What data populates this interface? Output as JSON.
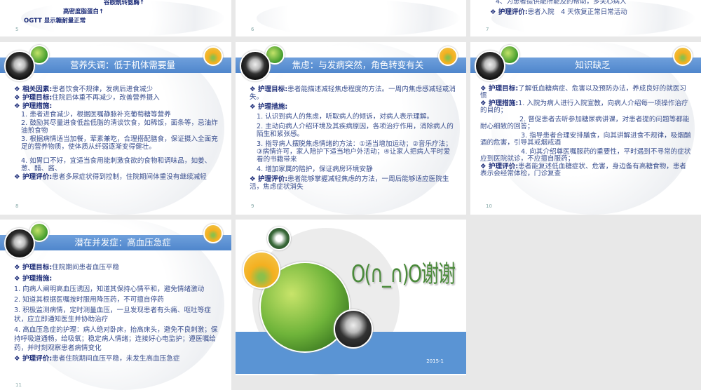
{
  "slides": [
    {
      "num": "5",
      "lines": [
        "谷胺酰转氨酶↑",
        "高密度脂蛋白↑",
        "OGTT 显示糖耐量正常"
      ]
    },
    {
      "num": "6"
    },
    {
      "num": "7",
      "lines": [
        "4、为患者提供能所能及的帮助，多关心病人"
      ],
      "eval_label": "护理评价:",
      "eval_text": "患者入院　4 天恢复正常日常活动"
    },
    {
      "num": "8",
      "title": "营养失调：低于机体需要量",
      "items": [
        {
          "label": "相关因素:",
          "text": "患者饮食不规律，发病后进食减少"
        },
        {
          "label": "护理目标:",
          "text": "住院后体重不再减少，改善营养摄入"
        },
        {
          "label": "护理措施:",
          "text": ""
        }
      ],
      "steps": [
        "1. 患者进食减少，根据医嘱静脉补充葡萄糖等营养",
        "2. 鼓励其尽量进食低盐低脂的清谈饮食，如稀饭，面条等，忌油炸油煎食物",
        "3. 根据病情适当加餐，荤素兼吃，合理搭配膳食，保证摄入全面充足的营养物质，使体质从纤弱逐渐变得健壮。",
        "4. 如胃口不好，宜适当食用能刺激食欲的食物和调味品，如姜、葱、醋、酱、"
      ],
      "eval_label": "护理评价:",
      "eval_text": "患者多尿症状得到控制，住院期间体重没有继续减轻"
    },
    {
      "num": "9",
      "title": "焦虑：与发病突然，角色转变有关",
      "items": [
        {
          "label": "护理目标:",
          "text": "患者能描述减轻焦虑程度的方法。一周内焦虑感减轻或消失。"
        },
        {
          "label": "护理措施:",
          "text": ""
        }
      ],
      "steps": [
        "1. 认识到病人的焦虑，听取病人的倾诉，对病人表示理解。",
        "2. 主动向病人介绍环境及其疾病原因，各项治疗作用，消除病人的陌生和紧张感。",
        "3. 指导病人摆脱焦虑情绪的方法：①适当增加运动；②音乐疗法；③病情许可，家人陪护下适当地户外活动；④让家人把病人平时爱看的书籍带来",
        "4. 增加家属的陪护，保证病房环境安静"
      ],
      "eval_label": "护理评价:",
      "eval_text": "患者能够掌握减轻焦虑的方法，一周后能够适应医院生活，焦虑症状消失"
    },
    {
      "num": "10",
      "title": "知识缺乏",
      "items": [
        {
          "label": "护理目标:",
          "text": "了解低血糖病症、危害以及预防办法，养成良好的就医习惯"
        },
        {
          "label": "护理措施:",
          "text": "1. 入院为病人进行入院宣教，向病人介绍每一项操作治疗的目的；"
        }
      ],
      "steps": [
        "2. 督促患者去听参加糖尿病讲课，对患者提的问题等都能耐心细致的回答；",
        "3. 指导患者合理安排膳食，向其讲解进食不规律，吸烟酗酒的危害，引导其戒烟戒酒",
        "4. 向其介绍尊医嘱服药的重要性，平时遇到不寻常的症状应到医院就诊，不应擅自服药；"
      ],
      "eval_label": "护理评价:",
      "eval_text": "患者能复述低血糖症状、危害，身边备有高糖食物，患者表示会经常体检，门诊复查"
    },
    {
      "num": "11",
      "title": "潜在并发症：高血压急症",
      "items": [
        {
          "label": "护理目标:",
          "text": "住院期间患者血压平稳"
        },
        {
          "label": "护理措施:",
          "text": ""
        }
      ],
      "steps": [
        "1. 向病人阐明高血压诱因，知道其保持心情平和，避免情绪激动",
        "2. 知道其根据医嘱按时服用降压药，不可擅自停药",
        "3. 积极监测病情，定时测量血压，一旦发现患者有头痛、呕吐等症状，应立即通知医生并协助治疗",
        "4. 高血压急症的护理：病人绝对卧床，抬高床头，避免不良刺激；保持呼吸道通畅，给吸氧；稳定病人情绪；连接好心电监护；遵医嘱给药，并时刻观察患者病情变化"
      ],
      "eval_label": "护理评价:",
      "eval_text": "患者住院期间血压平稳，未发生高血压急症"
    },
    {
      "title": "O(∩_∩)O谢谢",
      "date": "2015-1"
    }
  ],
  "colors": {
    "band": "#5b8fd0",
    "text": "#3a4f8f",
    "thanks": "#4a8a3a"
  }
}
